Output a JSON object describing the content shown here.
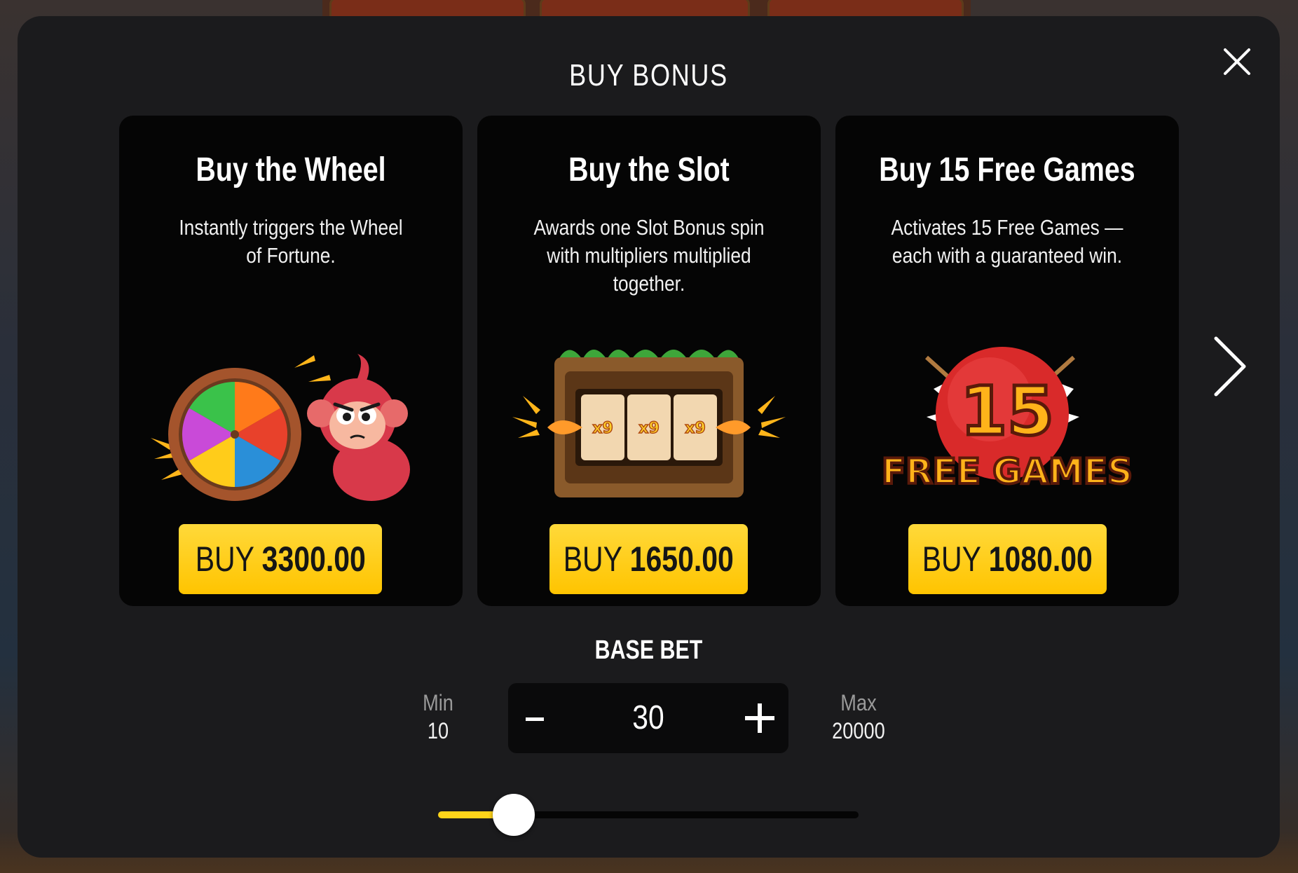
{
  "modal": {
    "title": "BUY BONUS",
    "close_icon": "close-icon",
    "next_icon": "chevron-right-icon"
  },
  "cards": [
    {
      "title": "Buy the Wheel",
      "description": "Instantly triggers the Wheel of Fortune.",
      "image": "wheel-of-fortune-monkey-image",
      "buy_label": "BUY",
      "price": "3300.00"
    },
    {
      "title": "Buy the Slot",
      "description": "Awards one Slot Bonus spin with multipliers multiplied together.",
      "image": "slot-machine-x9-image",
      "buy_label": "BUY",
      "price": "1650.00"
    },
    {
      "title": "Buy 15 Free Games",
      "description": "Activates 15 Free Games — each with a guaranteed win.",
      "image": "free-games-badge-image",
      "buy_label": "BUY",
      "price": "1080.00"
    }
  ],
  "art_text": {
    "slot_multiplier": "x9",
    "free_games_count": "15",
    "free_games_label": "FREE GAMES"
  },
  "base_bet": {
    "title": "BASE BET",
    "min_label": "Min",
    "min_value": "10",
    "max_label": "Max",
    "max_value": "20000",
    "value": "30",
    "slider_fraction": 0.18
  },
  "colors": {
    "modal_bg": "#1b1b1d",
    "card_bg": "#050505",
    "accent_yellow": "#ffc400",
    "text": "#ffffff"
  }
}
